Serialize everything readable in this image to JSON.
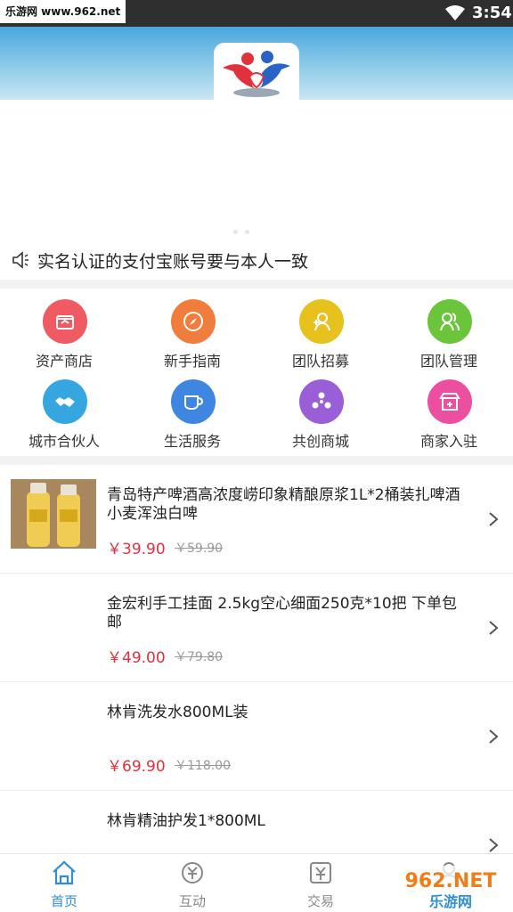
{
  "status_bar": {
    "watermark": "乐游网 www.962.net",
    "time": "3:54"
  },
  "notice": {
    "text": "实名认证的支付宝账号要与本人一致"
  },
  "grid": [
    {
      "label": "资产商店",
      "icon": "store-icon",
      "color": "#ef5a63"
    },
    {
      "label": "新手指南",
      "icon": "compass-icon",
      "color": "#f07d3b"
    },
    {
      "label": "团队招募",
      "icon": "add-user-icon",
      "color": "#e8c21c"
    },
    {
      "label": "团队管理",
      "icon": "users-icon",
      "color": "#6bc53a"
    },
    {
      "label": "城市合伙人",
      "icon": "handshake-icon",
      "color": "#35a6e0"
    },
    {
      "label": "生活服务",
      "icon": "cup-icon",
      "color": "#3f86e0"
    },
    {
      "label": "共创商城",
      "icon": "network-icon",
      "color": "#9a5fd6"
    },
    {
      "label": "商家入驻",
      "icon": "shop-add-icon",
      "color": "#ec4fa0"
    }
  ],
  "products": [
    {
      "title": "青岛特产啤酒高浓度崂印象精酿原浆1L*2桶装扎啤酒小麦浑浊白啤",
      "price": "￥39.90",
      "old_price": "￥59.90"
    },
    {
      "title": "金宏利手工挂面 2.5kg空心细面250克*10把 下单包邮",
      "price": "￥49.00",
      "old_price": "￥79.80"
    },
    {
      "title": "林肯洗发水800ML装",
      "price": "￥69.90",
      "old_price": "￥118.00"
    },
    {
      "title": "林肯精油护发1*800ML",
      "price": "",
      "old_price": ""
    }
  ],
  "bottom_nav": [
    {
      "label": "首页",
      "icon": "home-icon",
      "active": true
    },
    {
      "label": "互动",
      "icon": "exchange-icon",
      "active": false
    },
    {
      "label": "交易",
      "icon": "yen-icon",
      "active": false
    },
    {
      "label": "",
      "icon": "user-icon",
      "active": false
    }
  ],
  "watermark_bottom": {
    "text_top": "962.NET",
    "text_bottom": "乐游网"
  },
  "colors": {
    "accent": "#2e8fd6",
    "price": "#e0313c",
    "header": "#49a7dd"
  }
}
